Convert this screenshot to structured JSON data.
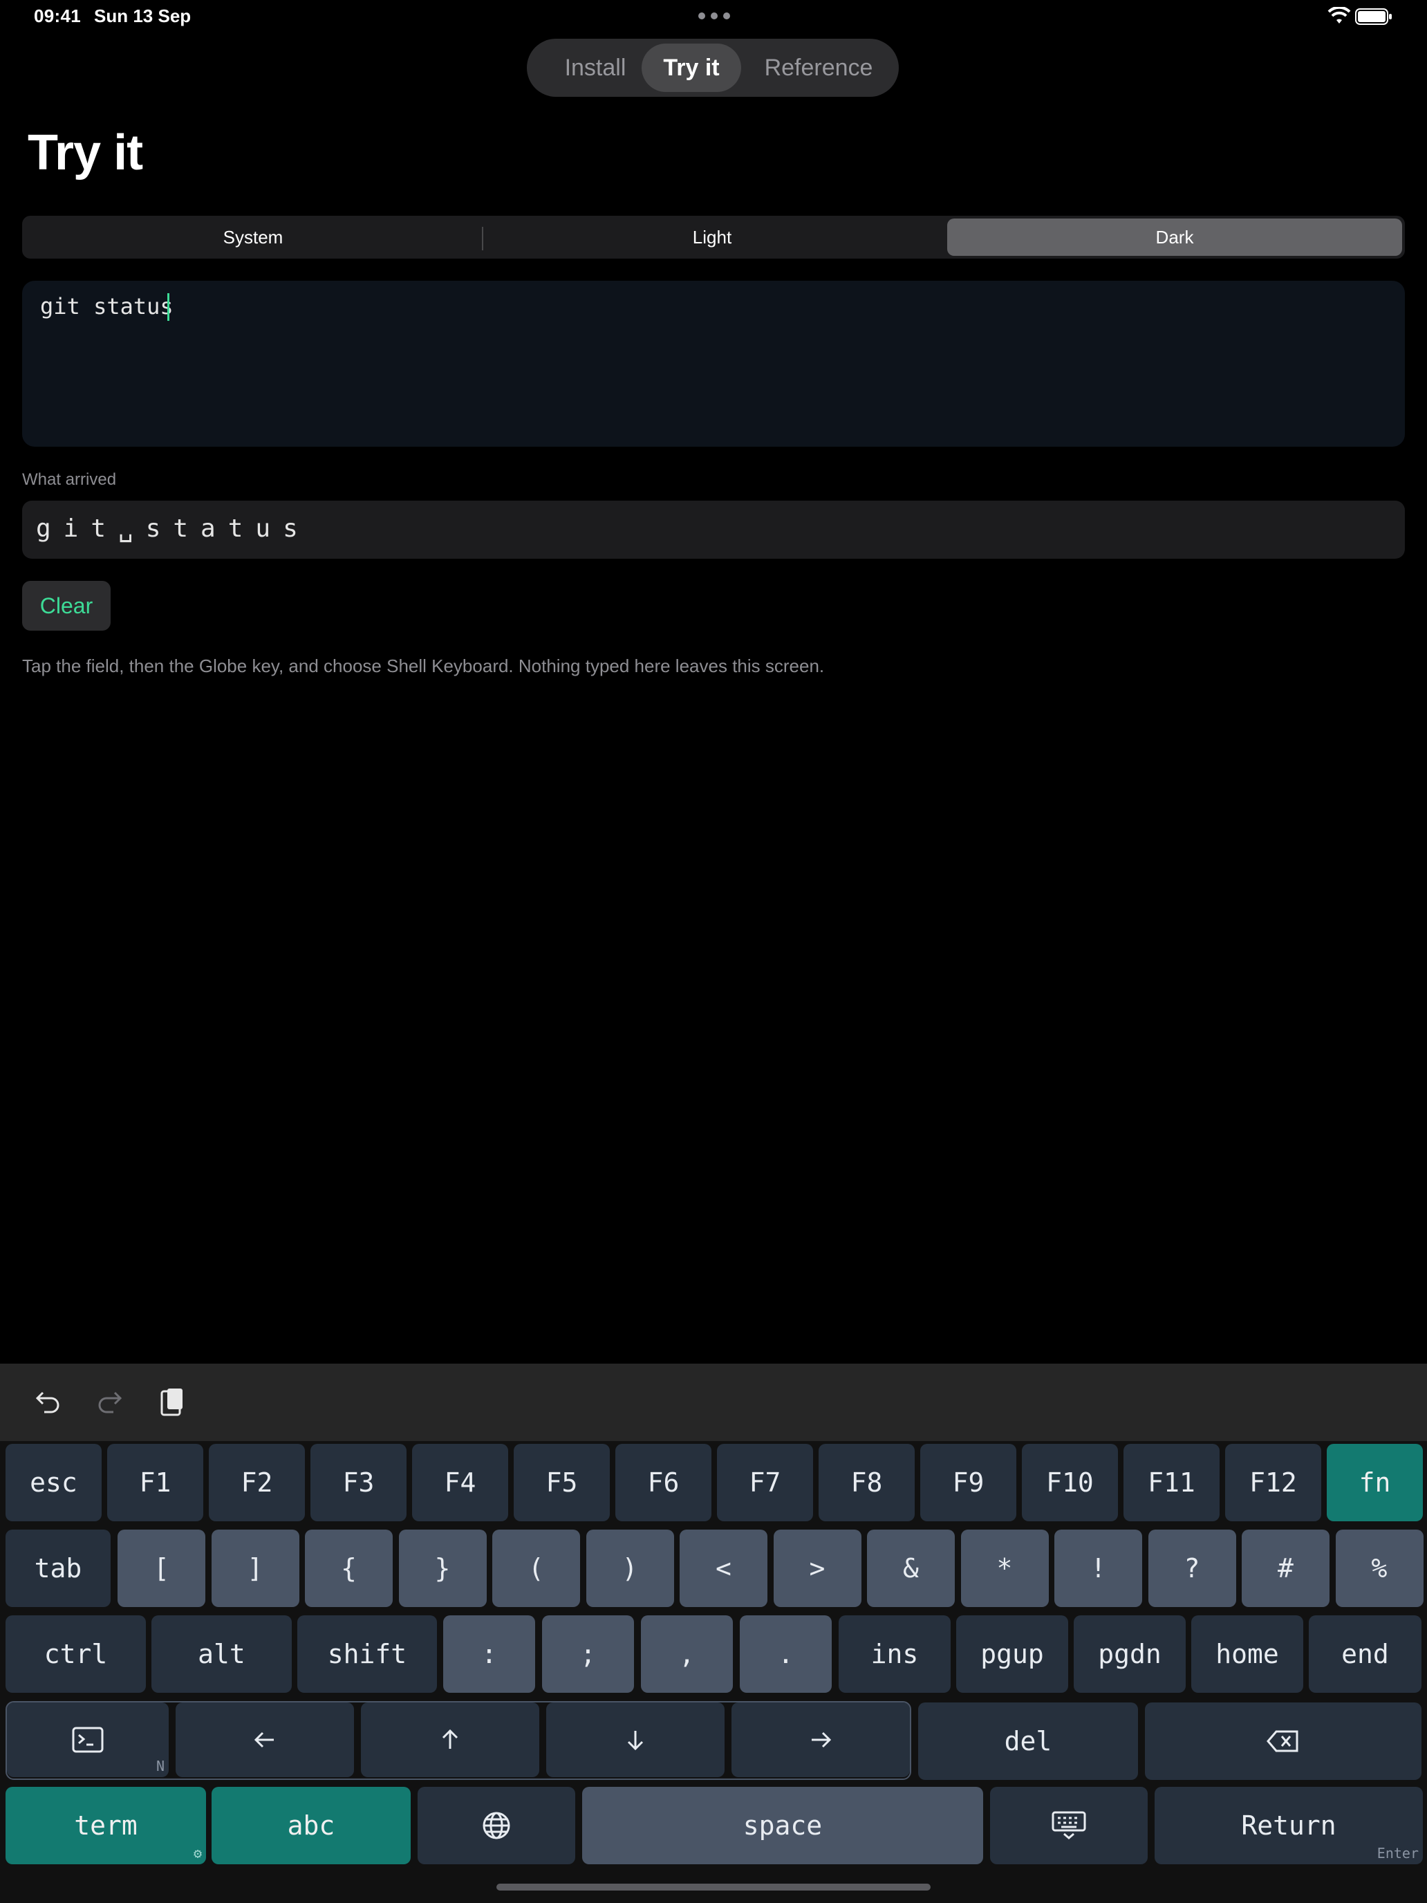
{
  "status_bar": {
    "time": "09:41",
    "date": "Sun 13 Sep"
  },
  "nav": {
    "tabs": [
      "Install",
      "Try it",
      "Reference"
    ],
    "active": "Try it"
  },
  "page_title": "Try it",
  "theme": {
    "options": [
      "System",
      "Light",
      "Dark"
    ],
    "selected": "Dark"
  },
  "input": {
    "value": "git status"
  },
  "arrived": {
    "label": "What arrived",
    "value": "git␣status"
  },
  "clear_label": "Clear",
  "hint": "Tap the field, then the Globe key, and choose Shell Keyboard. Nothing typed here leaves this screen.",
  "keyboard": {
    "row1": [
      "esc",
      "F1",
      "F2",
      "F3",
      "F4",
      "F5",
      "F6",
      "F7",
      "F8",
      "F9",
      "F10",
      "F11",
      "F12",
      "fn"
    ],
    "row2": [
      "tab",
      "[",
      "]",
      "{",
      "}",
      "(",
      ")",
      "<",
      ">",
      "&",
      "*",
      "!",
      "?",
      "#",
      "%"
    ],
    "row3": [
      "ctrl",
      "alt",
      "shift",
      ":",
      ";",
      ",",
      ".",
      "ins",
      "pgup",
      "pgdn",
      "home",
      "end"
    ],
    "del_label": "del",
    "term_badge": "N",
    "term_label": "term",
    "abc_label": "abc",
    "space_label": "space",
    "return_label": "Return",
    "return_sub": "Enter",
    "accent": "#137a70"
  }
}
